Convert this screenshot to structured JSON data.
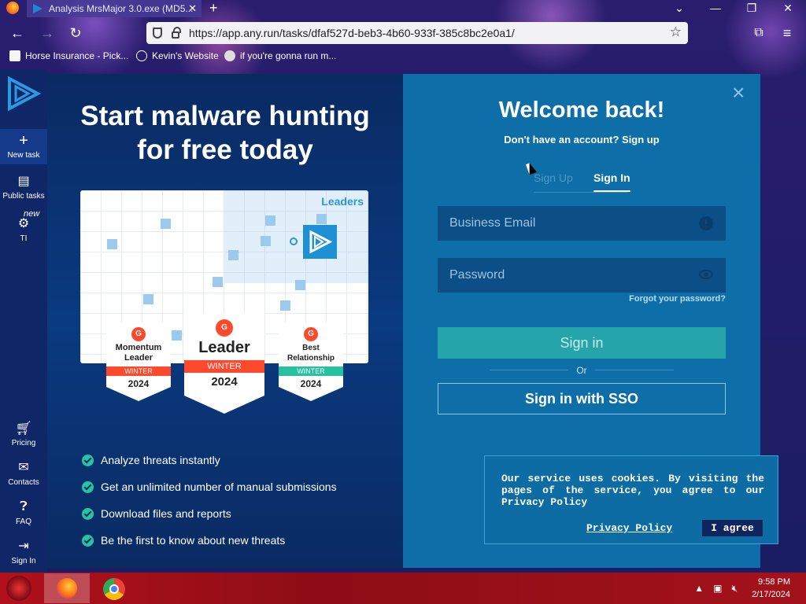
{
  "browser": {
    "tab_title": "Analysis MrsMajor 3.0.exe (MD5...",
    "url": "https://app.any.run/tasks/dfaf527d-beb3-4b60-933f-385c8bc2e0a1/",
    "bookmarks": [
      {
        "label": "Horse Insurance - Pick...",
        "icon": "horse-icon"
      },
      {
        "label": "Kevin's Website",
        "icon": "globe-icon"
      },
      {
        "label": "if you're gonna run m...",
        "icon": "skull-icon"
      }
    ]
  },
  "sidebar": {
    "items": [
      {
        "label": "New task",
        "icon": "plus-icon"
      },
      {
        "label": "Public tasks",
        "icon": "document-icon"
      },
      {
        "label": "TI",
        "icon": "gear-icon"
      },
      {
        "label": "Pricing",
        "icon": "cart-icon"
      },
      {
        "label": "Contacts",
        "icon": "mail-icon"
      },
      {
        "label": "FAQ",
        "icon": "help-icon"
      },
      {
        "label": "Sign In",
        "icon": "signin-icon"
      }
    ],
    "new_badge": "new"
  },
  "promo": {
    "title_line1": "Start malware hunting",
    "title_line2": "for free today",
    "leaders_label": "Leaders",
    "badges": [
      {
        "g2": "G",
        "title_line1": "Momentum",
        "title_line2": "Leader",
        "ribbon": "WINTER",
        "year": "2024"
      },
      {
        "g2": "G",
        "title_line1": "Leader",
        "ribbon": "WINTER",
        "year": "2024"
      },
      {
        "g2": "G",
        "title_line1": "Best",
        "title_line2": "Relationship",
        "ribbon": "WINTER",
        "year": "2024"
      }
    ],
    "features": [
      "Analyze threats instantly",
      "Get an unlimited number of manual submissions",
      "Download files and reports",
      "Be the first to know about new threats"
    ]
  },
  "auth": {
    "title": "Welcome back!",
    "subtitle": "Don't have an account? Sign up",
    "tab_signup": "Sign Up",
    "tab_signin": "Sign In",
    "email_placeholder": "Business Email",
    "password_placeholder": "Password",
    "forgot": "Forgot your password?",
    "signin_button": "Sign in",
    "or": "Or",
    "sso_button": "Sign in with SSO",
    "close": "×"
  },
  "cookie": {
    "text": "Our service uses cookies. By visiting the pages of the service, you agree to our Privacy Policy",
    "policy_link": "Privacy Policy",
    "agree": "I agree"
  },
  "taskbar": {
    "time": "9:58 PM",
    "date": "2/17/2024"
  },
  "colors": {
    "accent": "#25a5a9",
    "modal_left": "#0a2a62",
    "modal_right": "#0e6ea8",
    "taskbar": "#a3121b"
  }
}
